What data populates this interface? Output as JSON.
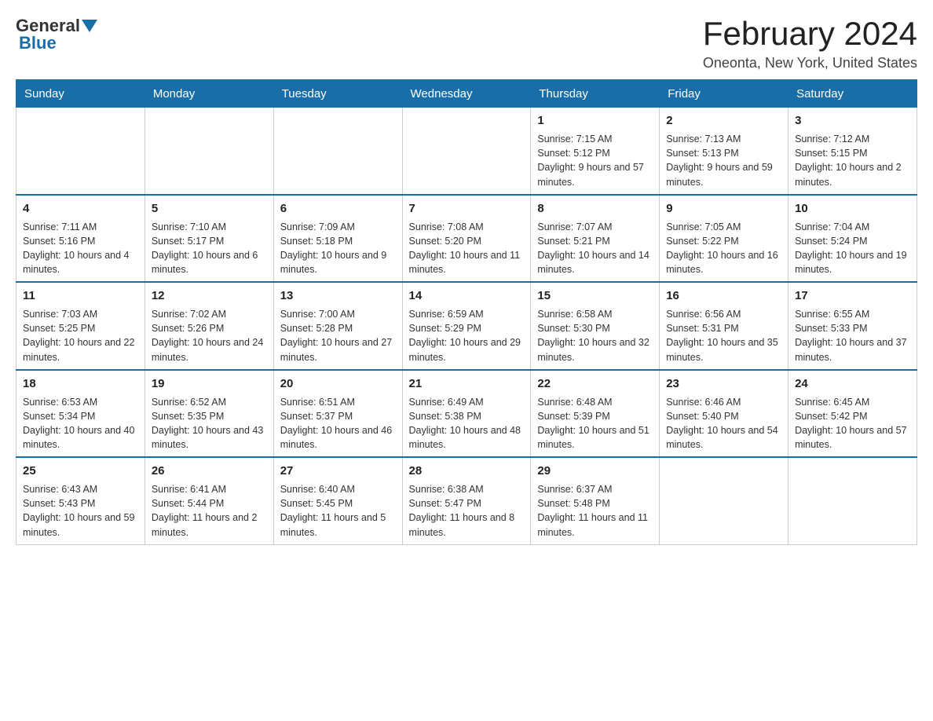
{
  "header": {
    "logo": {
      "part1": "General",
      "part2": "Blue"
    },
    "title": "February 2024",
    "subtitle": "Oneonta, New York, United States"
  },
  "days_of_week": [
    "Sunday",
    "Monday",
    "Tuesday",
    "Wednesday",
    "Thursday",
    "Friday",
    "Saturday"
  ],
  "weeks": [
    [
      {
        "day": "",
        "info": ""
      },
      {
        "day": "",
        "info": ""
      },
      {
        "day": "",
        "info": ""
      },
      {
        "day": "",
        "info": ""
      },
      {
        "day": "1",
        "info": "Sunrise: 7:15 AM\nSunset: 5:12 PM\nDaylight: 9 hours and 57 minutes."
      },
      {
        "day": "2",
        "info": "Sunrise: 7:13 AM\nSunset: 5:13 PM\nDaylight: 9 hours and 59 minutes."
      },
      {
        "day": "3",
        "info": "Sunrise: 7:12 AM\nSunset: 5:15 PM\nDaylight: 10 hours and 2 minutes."
      }
    ],
    [
      {
        "day": "4",
        "info": "Sunrise: 7:11 AM\nSunset: 5:16 PM\nDaylight: 10 hours and 4 minutes."
      },
      {
        "day": "5",
        "info": "Sunrise: 7:10 AM\nSunset: 5:17 PM\nDaylight: 10 hours and 6 minutes."
      },
      {
        "day": "6",
        "info": "Sunrise: 7:09 AM\nSunset: 5:18 PM\nDaylight: 10 hours and 9 minutes."
      },
      {
        "day": "7",
        "info": "Sunrise: 7:08 AM\nSunset: 5:20 PM\nDaylight: 10 hours and 11 minutes."
      },
      {
        "day": "8",
        "info": "Sunrise: 7:07 AM\nSunset: 5:21 PM\nDaylight: 10 hours and 14 minutes."
      },
      {
        "day": "9",
        "info": "Sunrise: 7:05 AM\nSunset: 5:22 PM\nDaylight: 10 hours and 16 minutes."
      },
      {
        "day": "10",
        "info": "Sunrise: 7:04 AM\nSunset: 5:24 PM\nDaylight: 10 hours and 19 minutes."
      }
    ],
    [
      {
        "day": "11",
        "info": "Sunrise: 7:03 AM\nSunset: 5:25 PM\nDaylight: 10 hours and 22 minutes."
      },
      {
        "day": "12",
        "info": "Sunrise: 7:02 AM\nSunset: 5:26 PM\nDaylight: 10 hours and 24 minutes."
      },
      {
        "day": "13",
        "info": "Sunrise: 7:00 AM\nSunset: 5:28 PM\nDaylight: 10 hours and 27 minutes."
      },
      {
        "day": "14",
        "info": "Sunrise: 6:59 AM\nSunset: 5:29 PM\nDaylight: 10 hours and 29 minutes."
      },
      {
        "day": "15",
        "info": "Sunrise: 6:58 AM\nSunset: 5:30 PM\nDaylight: 10 hours and 32 minutes."
      },
      {
        "day": "16",
        "info": "Sunrise: 6:56 AM\nSunset: 5:31 PM\nDaylight: 10 hours and 35 minutes."
      },
      {
        "day": "17",
        "info": "Sunrise: 6:55 AM\nSunset: 5:33 PM\nDaylight: 10 hours and 37 minutes."
      }
    ],
    [
      {
        "day": "18",
        "info": "Sunrise: 6:53 AM\nSunset: 5:34 PM\nDaylight: 10 hours and 40 minutes."
      },
      {
        "day": "19",
        "info": "Sunrise: 6:52 AM\nSunset: 5:35 PM\nDaylight: 10 hours and 43 minutes."
      },
      {
        "day": "20",
        "info": "Sunrise: 6:51 AM\nSunset: 5:37 PM\nDaylight: 10 hours and 46 minutes."
      },
      {
        "day": "21",
        "info": "Sunrise: 6:49 AM\nSunset: 5:38 PM\nDaylight: 10 hours and 48 minutes."
      },
      {
        "day": "22",
        "info": "Sunrise: 6:48 AM\nSunset: 5:39 PM\nDaylight: 10 hours and 51 minutes."
      },
      {
        "day": "23",
        "info": "Sunrise: 6:46 AM\nSunset: 5:40 PM\nDaylight: 10 hours and 54 minutes."
      },
      {
        "day": "24",
        "info": "Sunrise: 6:45 AM\nSunset: 5:42 PM\nDaylight: 10 hours and 57 minutes."
      }
    ],
    [
      {
        "day": "25",
        "info": "Sunrise: 6:43 AM\nSunset: 5:43 PM\nDaylight: 10 hours and 59 minutes."
      },
      {
        "day": "26",
        "info": "Sunrise: 6:41 AM\nSunset: 5:44 PM\nDaylight: 11 hours and 2 minutes."
      },
      {
        "day": "27",
        "info": "Sunrise: 6:40 AM\nSunset: 5:45 PM\nDaylight: 11 hours and 5 minutes."
      },
      {
        "day": "28",
        "info": "Sunrise: 6:38 AM\nSunset: 5:47 PM\nDaylight: 11 hours and 8 minutes."
      },
      {
        "day": "29",
        "info": "Sunrise: 6:37 AM\nSunset: 5:48 PM\nDaylight: 11 hours and 11 minutes."
      },
      {
        "day": "",
        "info": ""
      },
      {
        "day": "",
        "info": ""
      }
    ]
  ]
}
